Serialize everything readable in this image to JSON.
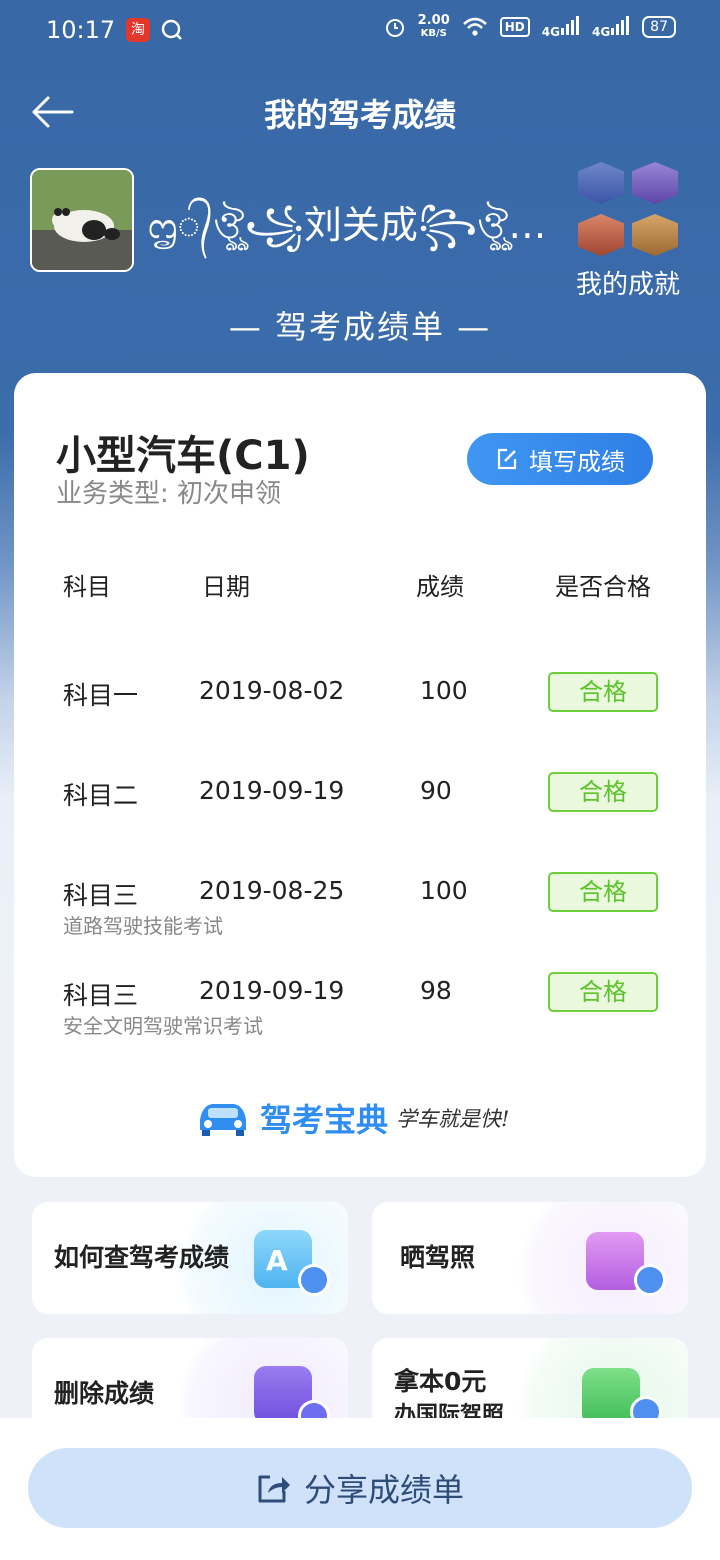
{
  "status_bar": {
    "time": "10:17",
    "app_icon_text": "淘",
    "net_speed_value": "2.00",
    "net_speed_unit": "KB/S",
    "hd_label": "HD",
    "signal1": "4G",
    "signal2": "4G",
    "battery": "87"
  },
  "header": {
    "title": "我的驾考成绩",
    "username": "ᦗ᭄ঔৣ꧁刘关成꧂ঔৣ…",
    "achievement_label": "我的成就",
    "sheet_title": "— 驾考成绩单 —"
  },
  "card": {
    "vehicle": "小型汽车(C1)",
    "business_type": "业务类型: 初次申领",
    "fill_button": "填写成绩",
    "columns": [
      "科目",
      "日期",
      "成绩",
      "是否合格"
    ],
    "rows": [
      {
        "subject": "科目一",
        "date": "2019-08-02",
        "score": "100",
        "result": "合格",
        "note": ""
      },
      {
        "subject": "科目二",
        "date": "2019-09-19",
        "score": "90",
        "result": "合格",
        "note": ""
      },
      {
        "subject": "科目三",
        "date": "2019-08-25",
        "score": "100",
        "result": "合格",
        "note": "道路驾驶技能考试"
      },
      {
        "subject": "科目三",
        "date": "2019-09-19",
        "score": "98",
        "result": "合格",
        "note": "安全文明驾驶常识考试"
      }
    ],
    "logo_name": "驾考宝典",
    "logo_slogan": "学车就是快!"
  },
  "tiles": {
    "query": "如何查驾考成绩",
    "show_license": "晒驾照",
    "delete": "删除成绩",
    "intl_line1": "拿本0元",
    "intl_line2": "办国际驾照"
  },
  "footer": {
    "share_button": "分享成绩单"
  },
  "colors": {
    "header_blue": "#3868a6",
    "accent_blue": "#2f7fe6",
    "pass_green": "#5dc32a",
    "share_bg": "#cfe2fa"
  }
}
